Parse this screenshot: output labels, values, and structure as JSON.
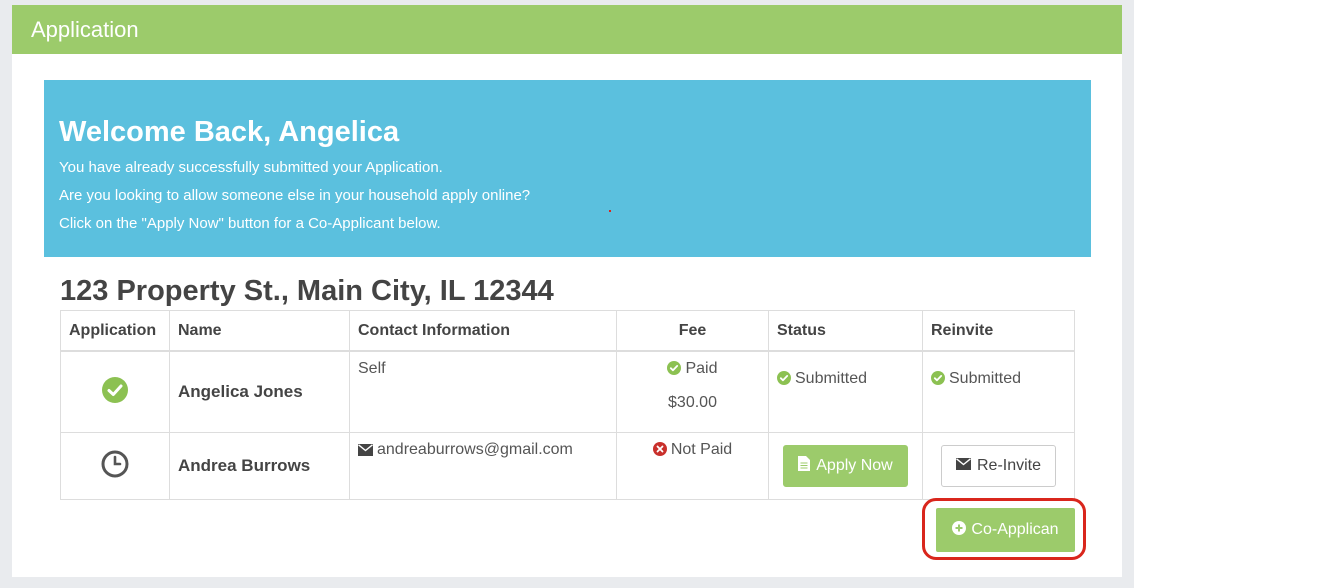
{
  "panel": {
    "title": "Application"
  },
  "banner": {
    "heading": "Welcome Back, Angelica",
    "line1": "You have already successfully submitted your Application.",
    "line2": "Are you looking to allow someone else in your household apply online?",
    "line3": "Click on the \"Apply Now\" button for a Co-Applicant below."
  },
  "property": {
    "address": "123 Property St., Main City, IL 12344"
  },
  "table": {
    "headers": {
      "application": "Application",
      "name": "Name",
      "contact": "Contact Information",
      "fee": "Fee",
      "status": "Status",
      "reinvite": "Reinvite"
    },
    "rows": [
      {
        "app_icon": "check-circle-icon",
        "name": "Angelica Jones",
        "contact": "Self",
        "fee_status": "Paid",
        "fee_amount": "$30.00",
        "status": "Submitted",
        "reinvite": "Submitted"
      },
      {
        "app_icon": "clock-icon",
        "name": "Andrea Burrows",
        "contact": "andreaburrows@gmail.com",
        "fee_status": "Not Paid",
        "status_button": "Apply Now",
        "reinvite_button": "Re-Invite"
      }
    ]
  },
  "actions": {
    "co_applicant_label": "Co-Applican"
  },
  "colors": {
    "header_green": "#9ccb6b",
    "banner_blue": "#5bc0de",
    "success_green": "#8cc152",
    "danger_red": "#d9261c",
    "highlight_red": "#d9261c"
  }
}
